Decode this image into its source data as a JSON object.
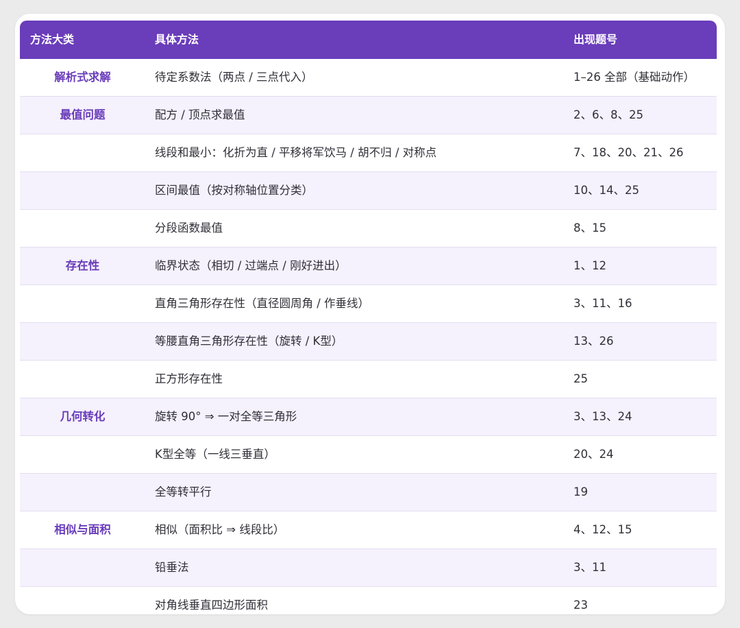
{
  "header": {
    "col1": "方法大类",
    "col2": "具体方法",
    "col3": "出现题号"
  },
  "rows": [
    {
      "category": "解析式求解",
      "method": "待定系数法（两点 / 三点代入）",
      "problems": "1–26 全部（基础动作）"
    },
    {
      "category": "最值问题",
      "method": "配方 / 顶点求最值",
      "problems": "2、6、8、25"
    },
    {
      "category": "",
      "method": "线段和最小：化折为直 / 平移将军饮马 / 胡不归 / 对称点",
      "problems": "7、18、20、21、26"
    },
    {
      "category": "",
      "method": "区间最值（按对称轴位置分类）",
      "problems": "10、14、25"
    },
    {
      "category": "",
      "method": "分段函数最值",
      "problems": "8、15"
    },
    {
      "category": "存在性",
      "method": "临界状态（相切 / 过端点 / 刚好进出）",
      "problems": "1、12"
    },
    {
      "category": "",
      "method": "直角三角形存在性（直径圆周角 / 作垂线）",
      "problems": "3、11、16"
    },
    {
      "category": "",
      "method": "等腰直角三角形存在性（旋转 / K型）",
      "problems": "13、26"
    },
    {
      "category": "",
      "method": "正方形存在性",
      "problems": "25"
    },
    {
      "category": "几何转化",
      "method": "旋转 90° ⇒ 一对全等三角形",
      "problems": "3、13、24"
    },
    {
      "category": "",
      "method": "K型全等（一线三垂直）",
      "problems": "20、24"
    },
    {
      "category": "",
      "method": "全等转平行",
      "problems": "19"
    },
    {
      "category": "相似与面积",
      "method": "相似（面积比 ⇒ 线段比）",
      "problems": "4、12、15"
    },
    {
      "category": "",
      "method": "铅垂法",
      "problems": "3、11"
    },
    {
      "category": "",
      "method": "对角线垂直四边形面积",
      "problems": "23"
    }
  ]
}
